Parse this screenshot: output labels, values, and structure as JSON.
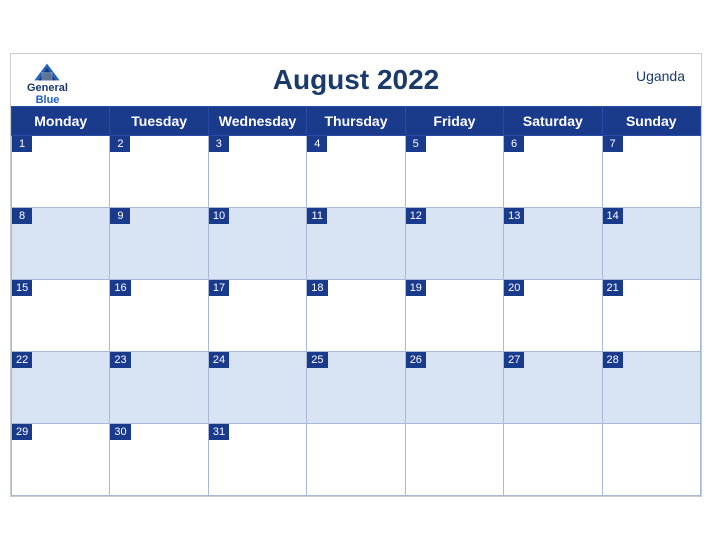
{
  "header": {
    "title": "August 2022",
    "country": "Uganda",
    "logo": {
      "line1": "General",
      "line2": "Blue"
    }
  },
  "weekdays": [
    "Monday",
    "Tuesday",
    "Wednesday",
    "Thursday",
    "Friday",
    "Saturday",
    "Sunday"
  ],
  "weeks": [
    [
      1,
      2,
      3,
      4,
      5,
      6,
      7
    ],
    [
      8,
      9,
      10,
      11,
      12,
      13,
      14
    ],
    [
      15,
      16,
      17,
      18,
      19,
      20,
      21
    ],
    [
      22,
      23,
      24,
      25,
      26,
      27,
      28
    ],
    [
      29,
      30,
      31,
      null,
      null,
      null,
      null
    ]
  ],
  "accent_color": "#1a3a8c",
  "row_even_bg": "#d8e4f4",
  "row_odd_bg": "#ffffff"
}
